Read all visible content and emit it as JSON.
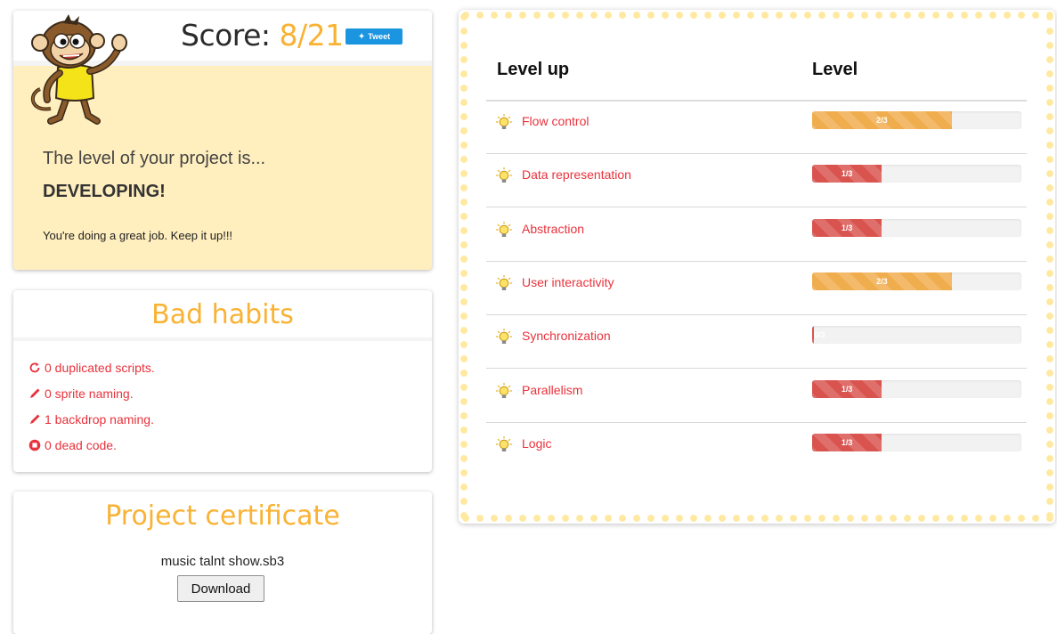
{
  "score": {
    "label": "Score:",
    "value": "8/21",
    "tweet_label": "Tweet",
    "level_intro": "The level of your project is...",
    "level_name": "DEVELOPING!",
    "encouragement": "You're doing a great job. Keep it up!!!"
  },
  "bad_habits": {
    "title": "Bad habits",
    "items": [
      {
        "icon": "refresh-icon",
        "text": "0 duplicated scripts."
      },
      {
        "icon": "pencil-icon",
        "text": "0 sprite naming."
      },
      {
        "icon": "pencil-icon",
        "text": "1 backdrop naming."
      },
      {
        "icon": "stop-icon",
        "text": "0 dead code."
      }
    ]
  },
  "certificate": {
    "title": "Project certificate",
    "file_name": "music talnt show.sb3",
    "download_label": "Download"
  },
  "levels": {
    "header_skill": "Level up",
    "header_level": "Level",
    "rows": [
      {
        "skill": "Flow control",
        "score": "2/3",
        "fraction": 0.667,
        "color": "#f0ad4e"
      },
      {
        "skill": "Data representation",
        "score": "1/3",
        "fraction": 0.333,
        "color": "#d9534f"
      },
      {
        "skill": "Abstraction",
        "score": "1/3",
        "fraction": 0.333,
        "color": "#d9534f"
      },
      {
        "skill": "User interactivity",
        "score": "2/3",
        "fraction": 0.667,
        "color": "#f0ad4e"
      },
      {
        "skill": "Synchronization",
        "score": "0/3",
        "fraction": 0,
        "color": "#d9534f"
      },
      {
        "skill": "Parallelism",
        "score": "1/3",
        "fraction": 0.333,
        "color": "#d9534f"
      },
      {
        "skill": "Logic",
        "score": "1/3",
        "fraction": 0.333,
        "color": "#d9534f"
      }
    ]
  },
  "colors": {
    "accent": "#f9b233",
    "link_red": "#e8323c",
    "panel_yellow": "#ffeebe",
    "tweet_blue": "#1b95e0"
  }
}
